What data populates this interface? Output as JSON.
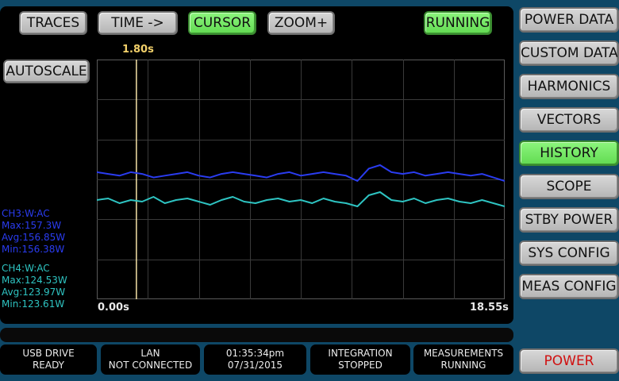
{
  "toolbar": {
    "traces": "TRACES",
    "time": "TIME ->",
    "cursor": "CURSOR",
    "zoom": "ZOOM+",
    "running": "RUNNING",
    "autoscale": "AUTOSCALE"
  },
  "sidebar": {
    "items": [
      {
        "label": "POWER DATA"
      },
      {
        "label": "CUSTOM DATA"
      },
      {
        "label": "HARMONICS"
      },
      {
        "label": "VECTORS"
      },
      {
        "label": "HISTORY"
      },
      {
        "label": "SCOPE"
      },
      {
        "label": "STBY POWER"
      },
      {
        "label": "SYS CONFIG"
      },
      {
        "label": "MEAS CONFIG"
      }
    ],
    "power": "POWER"
  },
  "plot": {
    "cursor_time": "1.80s",
    "x_start": "0.00s",
    "x_end": "18.55s"
  },
  "channels": {
    "ch3": {
      "label": "CH3:W:AC",
      "max": "Max:157.3W",
      "avg": "Avg:156.85W",
      "min": "Min:156.38W",
      "color": "#2a3cf0"
    },
    "ch4": {
      "label": "CH4:W:AC",
      "max": "Max:124.53W",
      "avg": "Avg:123.97W",
      "min": "Min:123.61W",
      "color": "#2ec4c2"
    }
  },
  "chart_data": {
    "type": "line",
    "x_range": [
      0.0,
      18.55
    ],
    "cursor_x": 1.8,
    "series": [
      {
        "name": "CH3:W:AC",
        "color": "#2a3cf0",
        "values": [
          156.9,
          156.8,
          156.7,
          156.9,
          156.8,
          156.6,
          156.7,
          156.8,
          156.9,
          156.7,
          156.6,
          156.8,
          156.9,
          156.8,
          156.7,
          156.6,
          156.8,
          156.9,
          156.7,
          156.8,
          156.9,
          156.8,
          156.7,
          156.4,
          157.1,
          157.3,
          156.9,
          156.8,
          156.9,
          156.7,
          156.8,
          156.9,
          156.8,
          156.7,
          156.8,
          156.6,
          156.4
        ]
      },
      {
        "name": "CH4:W:AC",
        "color": "#2ec4c2",
        "values": [
          124.0,
          124.1,
          123.8,
          124.0,
          123.9,
          124.2,
          123.8,
          124.0,
          124.1,
          123.9,
          123.7,
          124.0,
          124.2,
          123.9,
          123.8,
          124.0,
          124.1,
          123.9,
          124.0,
          123.8,
          124.1,
          123.9,
          123.8,
          123.6,
          124.3,
          124.5,
          124.0,
          123.9,
          124.1,
          123.8,
          124.0,
          124.1,
          123.9,
          123.8,
          124.0,
          123.8,
          123.6
        ]
      }
    ],
    "grid": true
  },
  "status": {
    "usb": {
      "line1": "USB DRIVE",
      "line2": "READY"
    },
    "lan": {
      "line1": "LAN",
      "line2": "NOT CONNECTED"
    },
    "clock": {
      "line1": "01:35:34pm",
      "line2": "07/31/2015"
    },
    "integration": {
      "line1": "INTEGRATION",
      "line2": "STOPPED"
    },
    "measurements": {
      "line1": "MEASUREMENTS",
      "line2": "RUNNING"
    }
  }
}
